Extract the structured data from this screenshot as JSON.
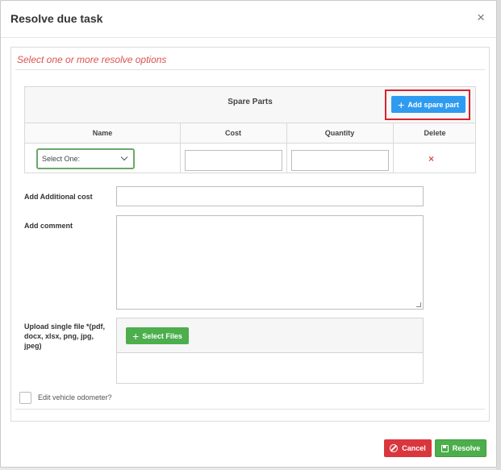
{
  "modal": {
    "title": "Resolve due task",
    "close_glyph": "×"
  },
  "instruction": "Select one or more resolve options",
  "spare_parts": {
    "title": "Spare Parts",
    "add_button_label": "Add spare part",
    "add_button_icon": "plus-icon",
    "columns": [
      "Name",
      "Cost",
      "Quantity",
      "Delete"
    ],
    "rows": [
      {
        "name_select_value": "Select One:",
        "cost": "",
        "quantity": "",
        "delete_glyph": "×"
      }
    ]
  },
  "form": {
    "additional_cost_label": "Add Additional cost",
    "additional_cost_value": "",
    "comment_label": "Add comment",
    "comment_value": "",
    "upload_label": "Upload single file *(pdf, docx, xlsx, png, jpg, jpeg)",
    "select_files_label": "Select Files",
    "select_files_icon": "plus-icon",
    "odometer_checkbox_label": "Edit vehicle odometer?",
    "odometer_checked": false
  },
  "footer": {
    "cancel_label": "Cancel",
    "cancel_icon": "ban-icon",
    "resolve_label": "Resolve",
    "resolve_icon": "save-icon"
  },
  "colors": {
    "instruction_text": "#d9534f",
    "primary_button": "#2f9bf0",
    "success_button": "#4cae4c",
    "danger_button": "#d9363e",
    "highlight_outline": "#d9232d",
    "select_border": "#6aa76a"
  }
}
